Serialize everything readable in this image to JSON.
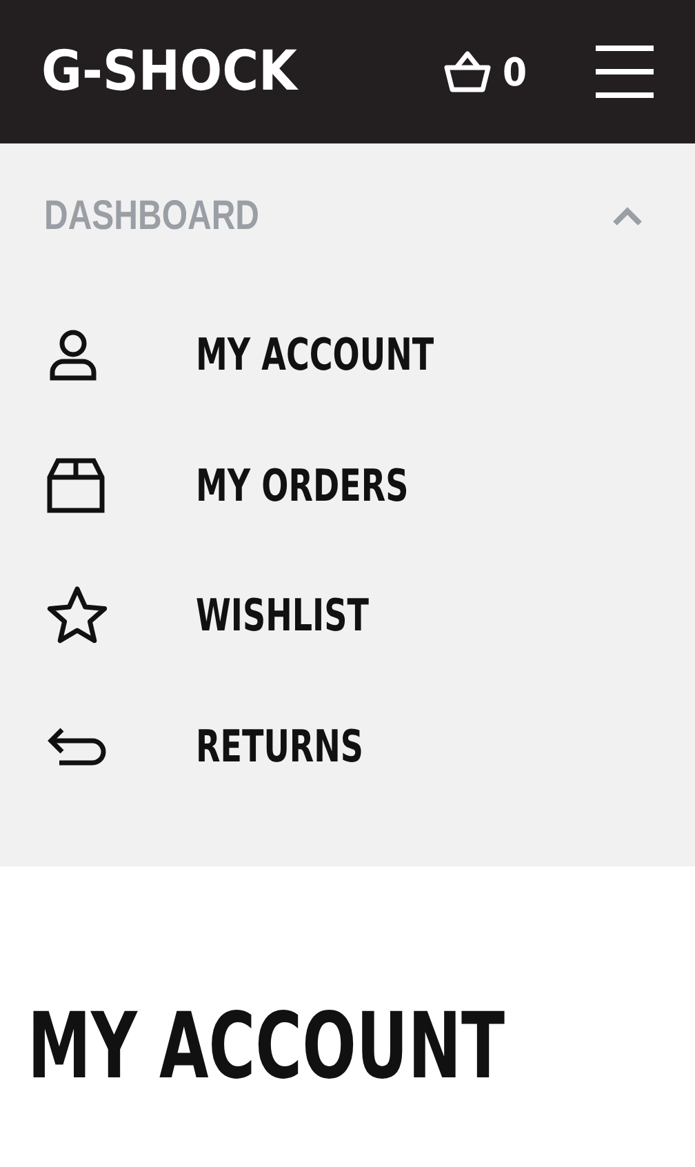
{
  "header": {
    "logo": "G-SHOCK",
    "cart_count": "0"
  },
  "dashboard": {
    "label": "DASHBOARD",
    "expanded": true,
    "items": [
      {
        "kind": "account",
        "label": "MY ACCOUNT"
      },
      {
        "kind": "orders",
        "label": "MY ORDERS"
      },
      {
        "kind": "wishlist",
        "label": "WISHLIST"
      },
      {
        "kind": "returns",
        "label": "RETURNS"
      }
    ]
  },
  "page_title": "MY ACCOUNT"
}
